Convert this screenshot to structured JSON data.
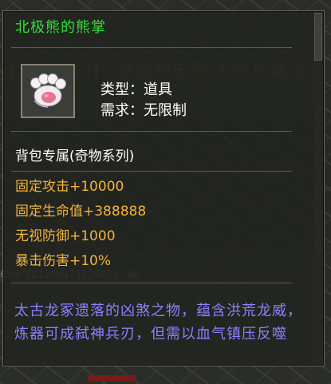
{
  "item": {
    "name": "北极熊的熊掌",
    "icon": "bear-paw-icon",
    "type_line": "类型：道具",
    "requirement_line": "需求：无限制",
    "bag_line": "背包专属(奇物系列)",
    "stats": [
      "固定攻击+10000",
      "固定生命值+388888",
      "无视防御+1000",
      "暴击伤害+10%"
    ],
    "lore": "太古龙冢遗落的凶煞之物，蕴含洪荒龙威，炼器可成弑神兵刃，但需以血气镇压反噬"
  },
  "colors": {
    "name": "#2fe03a",
    "stat": "#f2b43a",
    "lore": "#8a82ff",
    "meta": "#ffffff"
  }
}
